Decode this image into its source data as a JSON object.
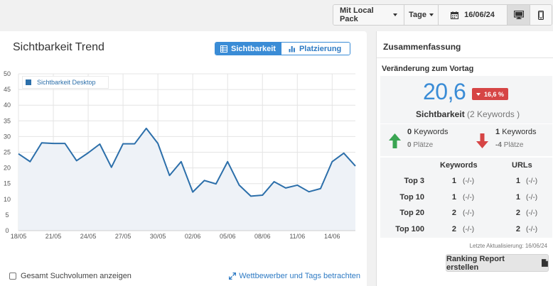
{
  "toolbar": {
    "local_pack": "Mit Local Pack",
    "period": "Tage",
    "date": "16/06/24",
    "device_desktop_icon": "desktop-icon",
    "device_mobile_icon": "mobile-icon"
  },
  "left": {
    "title": "Sichtbarkeit Trend",
    "toggle_visibility": "Sichtbarkeit",
    "toggle_ranking": "Platzierung",
    "legend": "Sichtbarkeit Desktop",
    "checkbox_label": "Gesamt Suchvolumen anzeigen",
    "link_label": "Wettbewerber und Tags betrachten"
  },
  "chart_data": {
    "type": "area",
    "ylim": [
      0,
      50
    ],
    "yticks": [
      0,
      5,
      10,
      15,
      20,
      25,
      30,
      35,
      40,
      45,
      50
    ],
    "x_tick_labels": [
      "18/05",
      "21/05",
      "24/05",
      "27/05",
      "30/05",
      "02/06",
      "05/06",
      "08/06",
      "11/06",
      "14/06"
    ],
    "x_dates": [
      "18/05",
      "19/05",
      "20/05",
      "21/05",
      "22/05",
      "23/05",
      "24/05",
      "25/05",
      "26/05",
      "27/05",
      "28/05",
      "29/05",
      "30/05",
      "31/05",
      "01/06",
      "02/06",
      "03/06",
      "04/06",
      "05/06",
      "06/06",
      "07/06",
      "08/06",
      "09/06",
      "10/06",
      "11/06",
      "12/06",
      "13/06",
      "14/06",
      "15/06",
      "16/06"
    ],
    "series": [
      {
        "name": "Sichtbarkeit Desktop",
        "color": "#2c6faa",
        "values": [
          24.5,
          22.0,
          28.0,
          27.8,
          27.8,
          22.3,
          24.8,
          27.6,
          20.2,
          27.7,
          27.7,
          32.6,
          27.8,
          17.6,
          22.0,
          12.3,
          16.0,
          14.9,
          22.0,
          14.5,
          11.0,
          11.3,
          15.6,
          13.6,
          14.5,
          12.4,
          13.4,
          22.0,
          24.7,
          20.6
        ]
      }
    ]
  },
  "summary": {
    "title": "Zusammenfassung",
    "subtitle": "Veränderung zum Vortag",
    "value": "20,6",
    "change": "16,6 %",
    "label": "Sichtbarkeit",
    "keywords_note": "(2 Keywords )",
    "up_count": "0",
    "up_label": "Keywords",
    "up_places": "0",
    "up_places_label": "Plätze",
    "down_count": "1",
    "down_label": "Keywords",
    "down_places": "-4",
    "down_places_label": "Plätze",
    "up_color": "#3aa553",
    "down_color": "#d64545",
    "col_keywords": "Keywords",
    "col_urls": "URLs",
    "rows": [
      {
        "label": "Top 3",
        "kw": "1",
        "kw_change": "(-/-)",
        "url": "1",
        "url_change": "(-/-)"
      },
      {
        "label": "Top 10",
        "kw": "1",
        "kw_change": "(-/-)",
        "url": "1",
        "url_change": "(-/-)"
      },
      {
        "label": "Top 20",
        "kw": "2",
        "kw_change": "(-/-)",
        "url": "2",
        "url_change": "(-/-)"
      },
      {
        "label": "Top 100",
        "kw": "2",
        "kw_change": "(-/-)",
        "url": "2",
        "url_change": "(-/-)"
      }
    ],
    "last_update": "Letzte Aktualisierung: 16/06/24",
    "report_button": "Ranking Report erstellen"
  }
}
